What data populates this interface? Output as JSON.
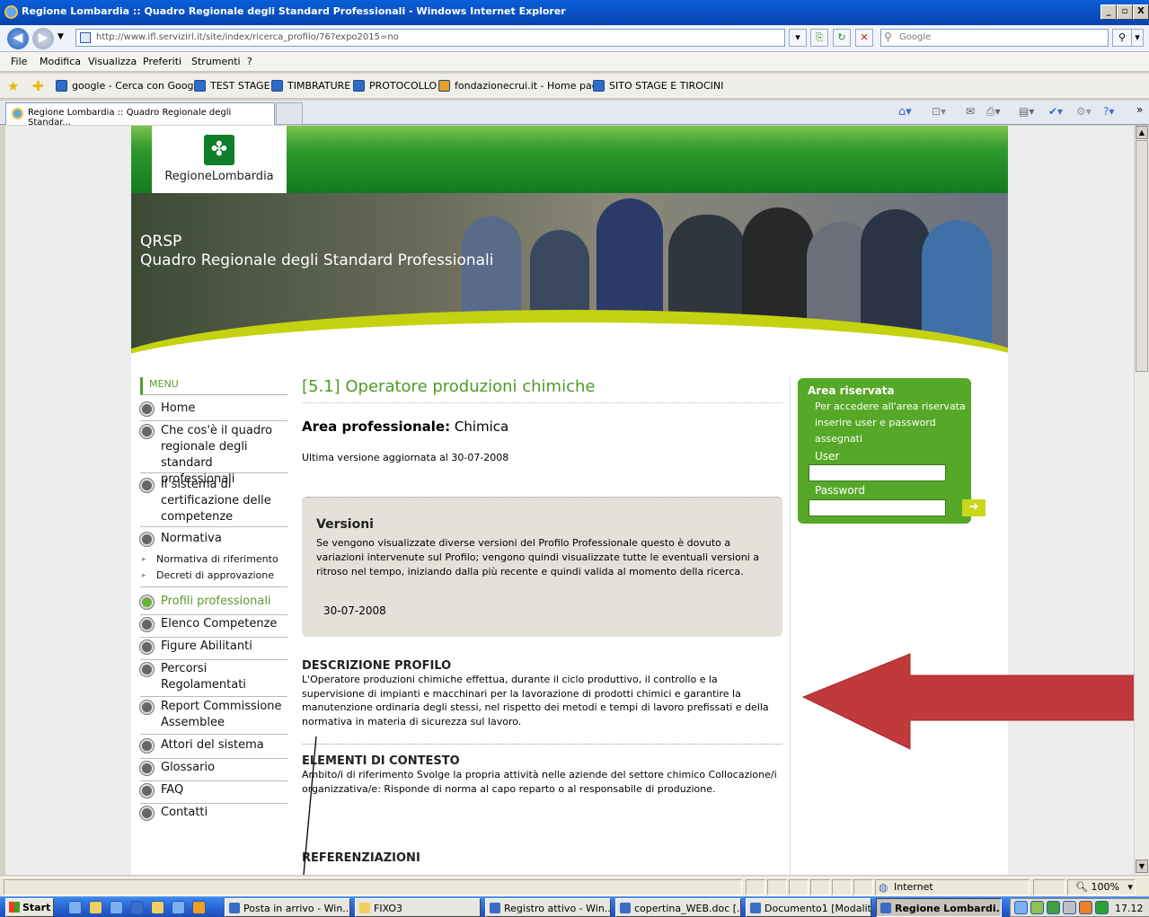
{
  "window": {
    "title": "Regione Lombardia :: Quadro Regionale degli Standard Professionali - Windows Internet Explorer",
    "controls": [
      "_",
      "▫",
      "X"
    ]
  },
  "address": {
    "url": "http://www.ifl.servizirl.it/site/index/ricerca_profilo/76?expo2015=no",
    "search_placeholder": "Google"
  },
  "menubar": [
    "File",
    "Modifica",
    "Visualizza",
    "Preferiti",
    "Strumenti",
    "?"
  ],
  "favorites": [
    "google - Cerca con Google",
    "TEST STAGE",
    "TIMBRATURE",
    "PROTOCOLLO",
    "fondazionecrui.it - Home page",
    "SITO STAGE E TIROCINI"
  ],
  "tab": {
    "label": "Regione Lombardia :: Quadro Regionale degli Standar..."
  },
  "site": {
    "logo_text": "RegioneLombardia",
    "banner_line1": "QRSP",
    "banner_line2": "Quadro Regionale degli Standard Professionali",
    "menu_title": "MENU",
    "menu": [
      "Home",
      "Che cos'è il quadro regionale degli standard professionali",
      "Il sistema di certificazione delle competenze",
      "Normativa",
      "Normativa di riferimento",
      "Decreti di approvazione",
      "Profili professionali",
      "Elenco Competenze",
      "Figure Abilitanti",
      "Percorsi Regolamentati",
      "Report Commissione Assemblee",
      "Attori del sistema",
      "Glossario",
      "FAQ",
      "Contatti"
    ],
    "title": "[5.1] Operatore produzioni chimiche",
    "area_label": "Area professionale:",
    "area_value": "Chimica",
    "updated": "Ultima versione aggiornata al 30-07-2008",
    "versions_title": "Versioni",
    "versions_text": "Se vengono visualizzate diverse versioni del Profilo Professionale questo è dovuto a variazioni intervenute sul Profilo; vengono quindi visualizzate tutte le eventuali versioni a ritroso nel tempo, iniziando dalla più recente e quindi valida al momento della ricerca.",
    "version_date": "30-07-2008",
    "desc_title": "DESCRIZIONE PROFILO",
    "desc_text": "L'Operatore produzioni chimiche effettua, durante il ciclo produttivo, il controllo e la supervisione di impianti e macchinari per la lavorazione di prodotti chimici e garantire la manutenzione ordinaria degli stessi, nel rispetto dei metodi e tempi di lavoro prefissati e della normativa in materia di sicurezza sul lavoro.",
    "context_title": "ELEMENTI DI CONTESTO",
    "context_text": "Ambito/i di riferimento Svolge la propria attività nelle aziende del settore chimico Collocazione/i organizzativa/e: Risponde di norma al capo reparto o al responsabile di produzione.",
    "ref_title": "REFERENZIAZIONI",
    "reserved_title": "Area riservata",
    "reserved_text": "Per accedere all'area riservata inserire user e password assegnati",
    "user_label": "User",
    "password_label": "Password"
  },
  "status": {
    "zone": "Internet",
    "zoom": "100%"
  },
  "taskbar": {
    "start": "Start",
    "tasks": [
      "Posta in arrivo - Win...",
      "FIXO3",
      "Registro attivo - Win...",
      "copertina_WEB.doc [...",
      "Documento1 [Modalit...",
      "Regione Lombardi..."
    ],
    "clock": "17.12"
  },
  "colors": {
    "green": "#56a828",
    "title_green": "#4f9a26",
    "arrow": "#c0393b",
    "xp_blue": "#0842b0"
  }
}
